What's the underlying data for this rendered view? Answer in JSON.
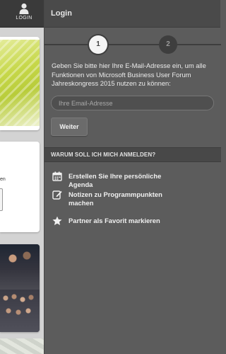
{
  "topbar": {
    "login_tab_label": "LOGIN",
    "login_icon": "user-icon"
  },
  "background_app": {
    "card2_text": "en"
  },
  "panel": {
    "title": "Login",
    "steps": [
      "1",
      "2"
    ],
    "active_step": "1",
    "intro_text": "Geben Sie bitte hier Ihre E-Mail-Adresse ein, um alle Funktionen von Microsoft Business User Forum Jahreskongress 2015 nutzen zu können:",
    "email_placeholder": "Ihre Email-Adresse",
    "email_value": "",
    "submit_label": "Weiter",
    "why_header": "WARUM SOLL ICH MICH ANMELDEN?",
    "benefits": [
      {
        "icon": "calendar-icon",
        "label": "Erstellen Sie Ihre persönliche Agenda"
      },
      {
        "icon": "edit-note-icon",
        "label": "Notizen zu Programmpunkten machen"
      },
      {
        "icon": "star-icon",
        "label": "Partner als Favorit markieren"
      }
    ]
  },
  "colors": {
    "panel_bg": "#5c5c5c",
    "header_bg": "#4a4a4a",
    "step_active": "#f4f4f4",
    "step_inactive": "#3e3e3e",
    "text": "#ebebeb"
  }
}
